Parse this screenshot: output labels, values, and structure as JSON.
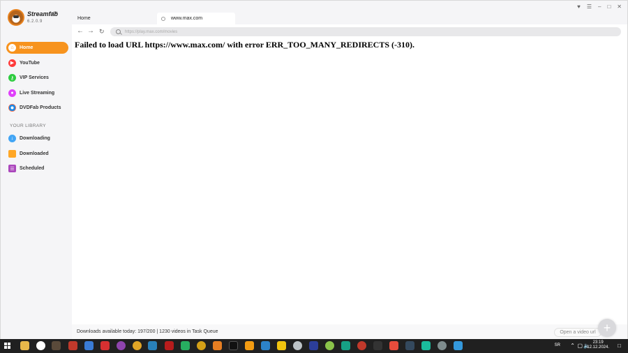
{
  "app": {
    "name": "Streamfab",
    "arch": "x64",
    "version": "6.2.0.9"
  },
  "sidebar": {
    "nav": [
      {
        "label": "Home",
        "icon": "home-icon",
        "color": "#f7931e"
      },
      {
        "label": "YouTube",
        "icon": "youtube-icon",
        "color": "#ff3b3b"
      },
      {
        "label": "VIP Services",
        "icon": "key-icon",
        "color": "#2ecc40"
      },
      {
        "label": "Live Streaming",
        "icon": "camera-icon",
        "color": "#e040fb"
      },
      {
        "label": "DVDFab Products",
        "icon": "dvdfab-icon",
        "color": "#1e88e5"
      }
    ],
    "library_heading": "YOUR LIBRARY",
    "library": [
      {
        "label": "Downloading",
        "icon": "download-icon",
        "color": "#42a5f5"
      },
      {
        "label": "Downloaded",
        "icon": "folder-icon",
        "color": "#ffa726"
      },
      {
        "label": "Scheduled",
        "icon": "calendar-icon",
        "color": "#ab47bc"
      }
    ]
  },
  "tabs": [
    {
      "label": "Home"
    },
    {
      "label": "www.max.com"
    }
  ],
  "address": {
    "placeholder": "https://play.max.com/movies"
  },
  "content": {
    "error": "Failed to load URL https://www.max.com/ with error ERR_TOO_MANY_REDIRECTS (-310)."
  },
  "status": {
    "text": "Downloads available today: 197/200 | 1230 videos in Task Queue",
    "open_url_label": "Open a video url"
  },
  "taskbar": {
    "lang": "SR",
    "time": "23:19",
    "date": "12.12.2024."
  }
}
